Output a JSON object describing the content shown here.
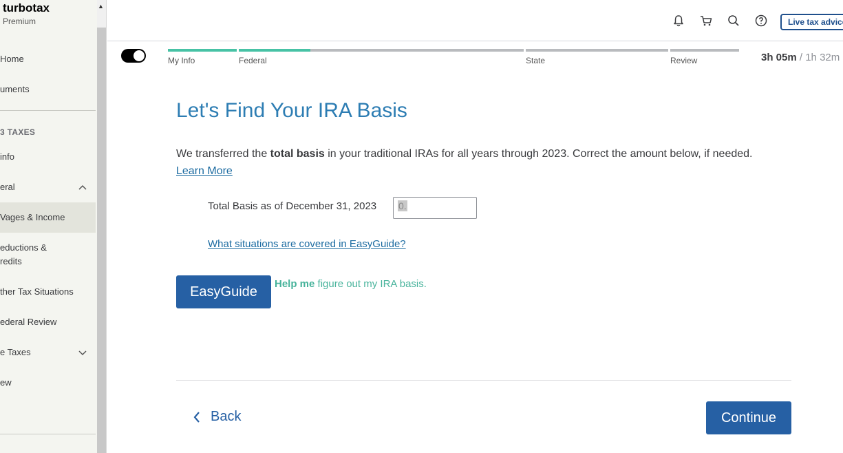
{
  "sidebar": {
    "brand": "turbotax",
    "edition": "Premium",
    "items": [
      {
        "label": "Home"
      },
      {
        "label": "uments"
      },
      {
        "label": "info"
      },
      {
        "label": "eral"
      },
      {
        "label": "Vages & Income"
      },
      {
        "label": "eductions & redits"
      },
      {
        "label": "ther Tax Situations"
      },
      {
        "label": "ederal Review"
      },
      {
        "label": "e Taxes"
      },
      {
        "label": "ew"
      }
    ],
    "section_heading": "3 TAXES"
  },
  "header": {
    "live_button": "Live tax advice",
    "icons": [
      "bell-icon",
      "cart-icon",
      "search-icon",
      "help-icon"
    ]
  },
  "progress": {
    "steps": [
      {
        "label": "My Info",
        "fill": 1.0
      },
      {
        "label": "Federal",
        "fill": 0.25
      },
      {
        "label": "State",
        "fill": 0
      },
      {
        "label": "Review",
        "fill": 0
      }
    ],
    "timer_main": "3h 05m",
    "timer_sep": " / ",
    "timer_total": "1h 32m"
  },
  "main": {
    "title": "Let's Find Your IRA Basis",
    "desc_pre": "We transferred the ",
    "desc_bold": "total basis",
    "desc_post": " in your traditional IRAs for all years through 2023. Correct the amount below, if needed.",
    "learn_more": "Learn More",
    "field_label": "Total Basis as of December 31, 2023",
    "field_value": "0.",
    "situations_link": "What situations are covered in EasyGuide?",
    "easyguide_button": "EasyGuide",
    "help_bold": "Help me",
    "help_rest": " figure out my IRA basis.",
    "back_label": "Back",
    "continue_label": "Continue"
  },
  "colors": {
    "primary_blue": "#2660a4",
    "title_blue": "#2d7db3",
    "progress_green": "#47c2a5"
  }
}
